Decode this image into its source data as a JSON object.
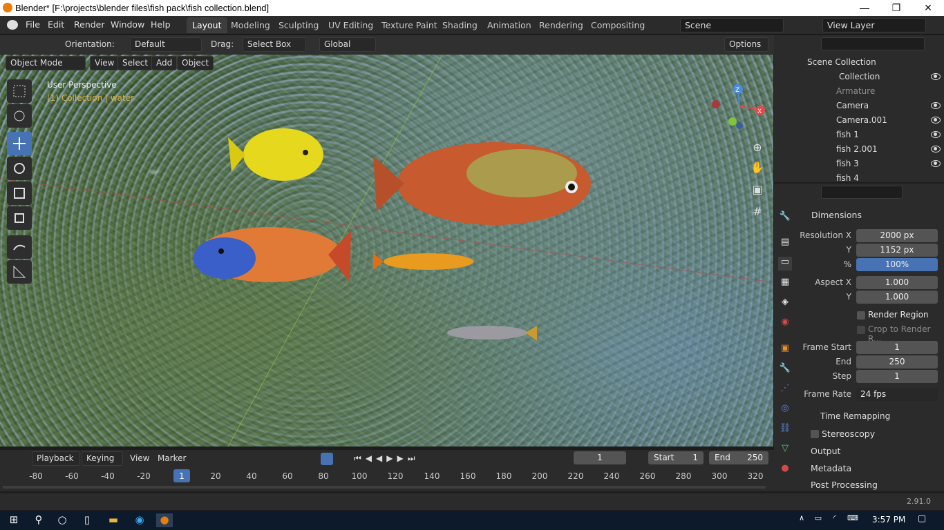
{
  "window": {
    "title": "Blender* [F:\\projects\\blender files\\fish pack\\fish collection.blend]",
    "minimize": "—",
    "restore": "❐",
    "close": "✕"
  },
  "menu": [
    "File",
    "Edit",
    "Render",
    "Window",
    "Help"
  ],
  "workspaces": [
    "Layout",
    "Modeling",
    "Sculpting",
    "UV Editing",
    "Texture Paint",
    "Shading",
    "Animation",
    "Rendering",
    "Compositing"
  ],
  "scene": "Scene",
  "view_layer": "View Layer",
  "tool_header": {
    "orientation_label": "Orientation:",
    "orientation": "Default",
    "drag_label": "Drag:",
    "drag": "Select Box",
    "transform": "Global",
    "options": "Options"
  },
  "viewport_header": {
    "mode": "Object Mode",
    "view": "View",
    "select": "Select",
    "add": "Add",
    "object": "Object"
  },
  "viewport": {
    "perspective": "User Perspective",
    "collection": "(1) Collection | water"
  },
  "outliner": {
    "root": "Scene Collection",
    "collection": "Collection",
    "items": [
      "Armature",
      "Camera",
      "Camera.001",
      "fish 1",
      "fish 2.001",
      "fish 3",
      "fish 4"
    ]
  },
  "properties": {
    "dimensions": "Dimensions",
    "resolution_x_label": "Resolution X",
    "resolution_x": "2000 px",
    "resolution_y_label": "Y",
    "resolution_y": "1152 px",
    "percent_label": "%",
    "percent": "100%",
    "aspect_x_label": "Aspect X",
    "aspect_x": "1.000",
    "aspect_y_label": "Y",
    "aspect_y": "1.000",
    "render_region": "Render Region",
    "crop": "Crop to Render R...",
    "frame_start_label": "Frame Start",
    "frame_start": "1",
    "end_label": "End",
    "end": "250",
    "step_label": "Step",
    "step": "1",
    "frame_rate_label": "Frame Rate",
    "frame_rate": "24 fps",
    "time_remapping": "Time Remapping",
    "stereoscopy": "Stereoscopy",
    "output": "Output",
    "metadata": "Metadata",
    "post_processing": "Post Processing"
  },
  "timeline": {
    "playback": "Playback",
    "keying": "Keying",
    "view": "View",
    "marker": "Marker",
    "current": "1",
    "start_label": "Start",
    "start": "1",
    "end_label": "End",
    "end": "250",
    "ticks": [
      "-80",
      "-60",
      "-40",
      "-20",
      "1",
      "20",
      "40",
      "60",
      "80",
      "100",
      "120",
      "140",
      "160",
      "180",
      "200",
      "220",
      "240",
      "260",
      "280",
      "300",
      "320"
    ]
  },
  "status": {
    "version": "2.91.0"
  },
  "taskbar": {
    "time": "3:57 PM"
  }
}
